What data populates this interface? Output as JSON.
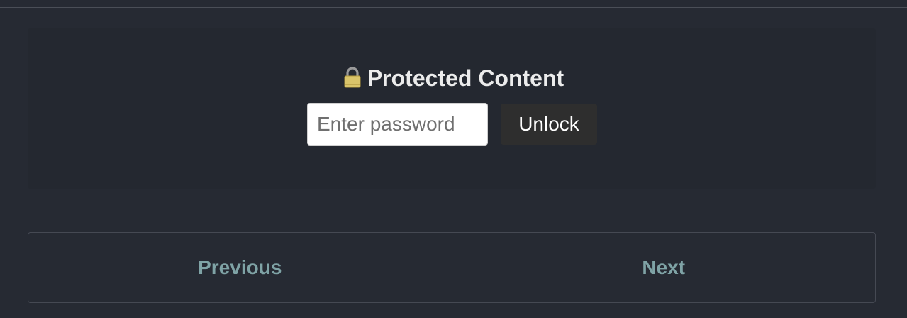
{
  "protected": {
    "icon": "lock-icon",
    "title": "Protected Content",
    "password_placeholder": "Enter password",
    "password_value": "",
    "unlock_label": "Unlock"
  },
  "pager": {
    "previous_label": "Previous",
    "next_label": "Next"
  },
  "colors": {
    "background": "#262a33",
    "panel": "#242830",
    "link": "#7fa3a6",
    "button": "#2e2e2e"
  }
}
